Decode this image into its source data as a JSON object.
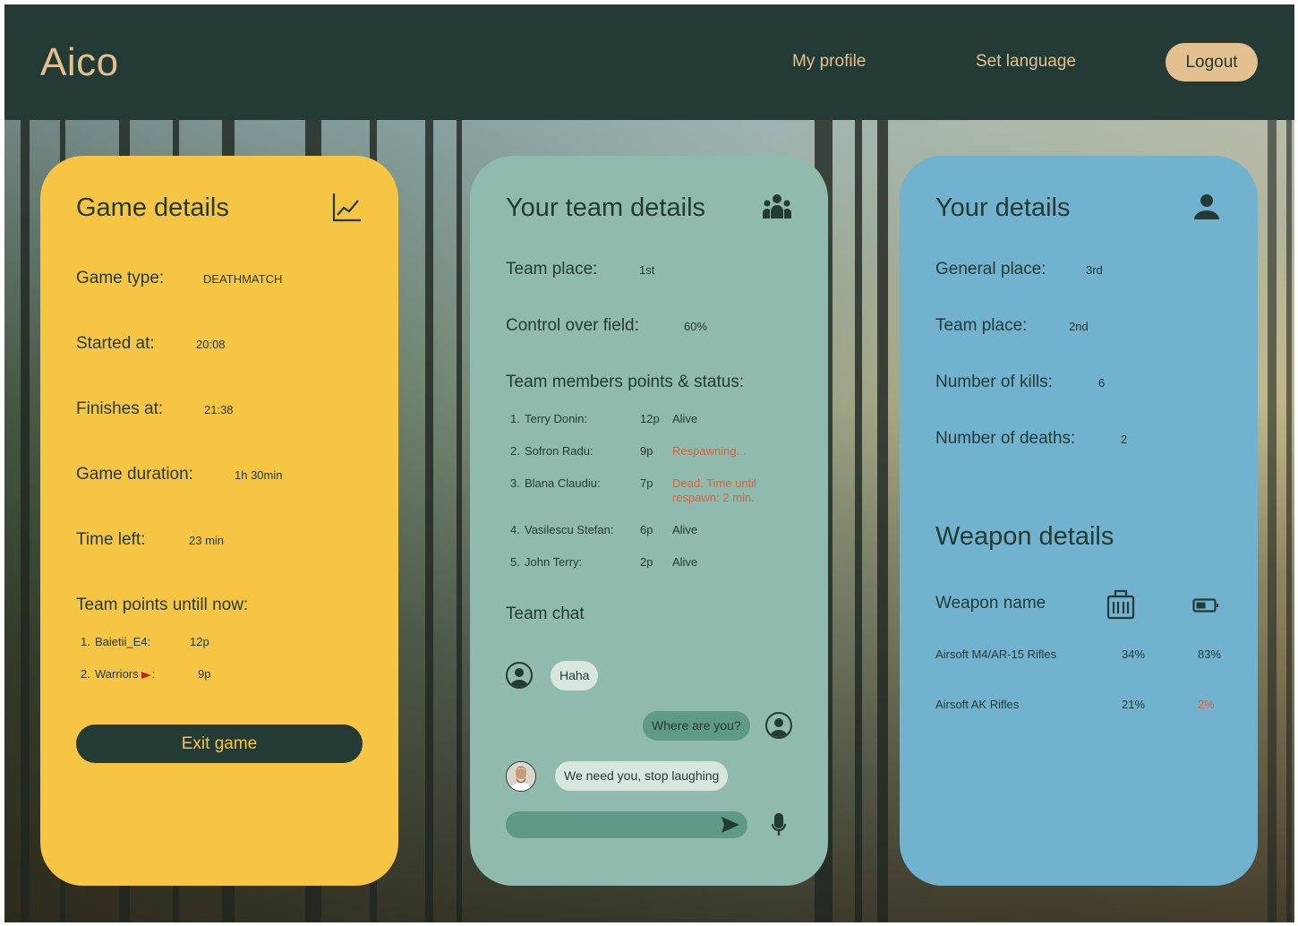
{
  "header": {
    "logo": "Aico",
    "nav": {
      "profile": "My profile",
      "language": "Set language"
    },
    "logout": "Logout"
  },
  "game": {
    "title": "Game details",
    "icon": "chart-line-icon",
    "rows": [
      {
        "label": "Game type:",
        "value": "DEATHMATCH"
      },
      {
        "label": "Started at:",
        "value": "20:08"
      },
      {
        "label": "Finishes at:",
        "value": "21:38"
      },
      {
        "label": "Game duration:",
        "value": "1h 30min"
      },
      {
        "label": "Time left:",
        "value": "23 min"
      }
    ],
    "team_points_title": "Team points untill now:",
    "team_points": [
      {
        "rank": "1.",
        "name": "Baietii_E4:",
        "points": "12p"
      },
      {
        "rank": "2.",
        "name": "Warriors",
        "suffix": ":",
        "points": "9p"
      }
    ],
    "exit": "Exit game"
  },
  "team": {
    "title": "Your team details",
    "icon": "group-icon",
    "place_label": "Team place:",
    "place_value": "1st",
    "control_label": "Control over field:",
    "control_value": "60%",
    "members_title": "Team members points & status:",
    "members": [
      {
        "rank": "1.",
        "name": "Terry Donin:",
        "points": "12p",
        "status": "Alive"
      },
      {
        "rank": "2.",
        "name": "Sofron Radu:",
        "points": "9p",
        "status": "Respawning..."
      },
      {
        "rank": "3.",
        "name": "Blana Claudiu:",
        "points": "7p",
        "status": "Dead. Time until",
        "status2": "respawn: 2 min."
      },
      {
        "rank": "4.",
        "name": "Vasilescu Stefan:",
        "points": "6p",
        "status": "Alive"
      },
      {
        "rank": "5.",
        "name": "John Terry:",
        "points": "2p",
        "status": "Alive"
      }
    ],
    "chat_title": "Team chat",
    "messages": [
      {
        "text": "Haha"
      },
      {
        "text": "Where are you?"
      },
      {
        "text": "We need you, stop laughing"
      }
    ],
    "status_colors": {
      "alive": "#243b35",
      "warning": "#e2603a"
    }
  },
  "you": {
    "title": "Your details",
    "icon": "person-icon",
    "rows": [
      {
        "label": "General place:",
        "value": "3rd"
      },
      {
        "label": "Team place:",
        "value": "2nd"
      },
      {
        "label": "Number of kills:",
        "value": "6"
      },
      {
        "label": "Number of deaths:",
        "value": "2"
      }
    ],
    "weapon_title": "Weapon details",
    "weapon_header": "Weapon name",
    "weapon_icons": [
      "ammo-icon",
      "battery-icon"
    ],
    "weapons": [
      {
        "name": "Airsoft M4/AR-15 Rifles",
        "ammo": "34%",
        "battery": "83%"
      },
      {
        "name": "Airsoft AK Rifles",
        "ammo": "21%",
        "battery": "2%"
      }
    ]
  },
  "colors": {
    "header": "#243b35",
    "accent": "#e3c08e",
    "game_card": "#f7c544",
    "team_card": "#8fbaad",
    "you_card": "#71b2cf",
    "alert": "#e2603a"
  }
}
